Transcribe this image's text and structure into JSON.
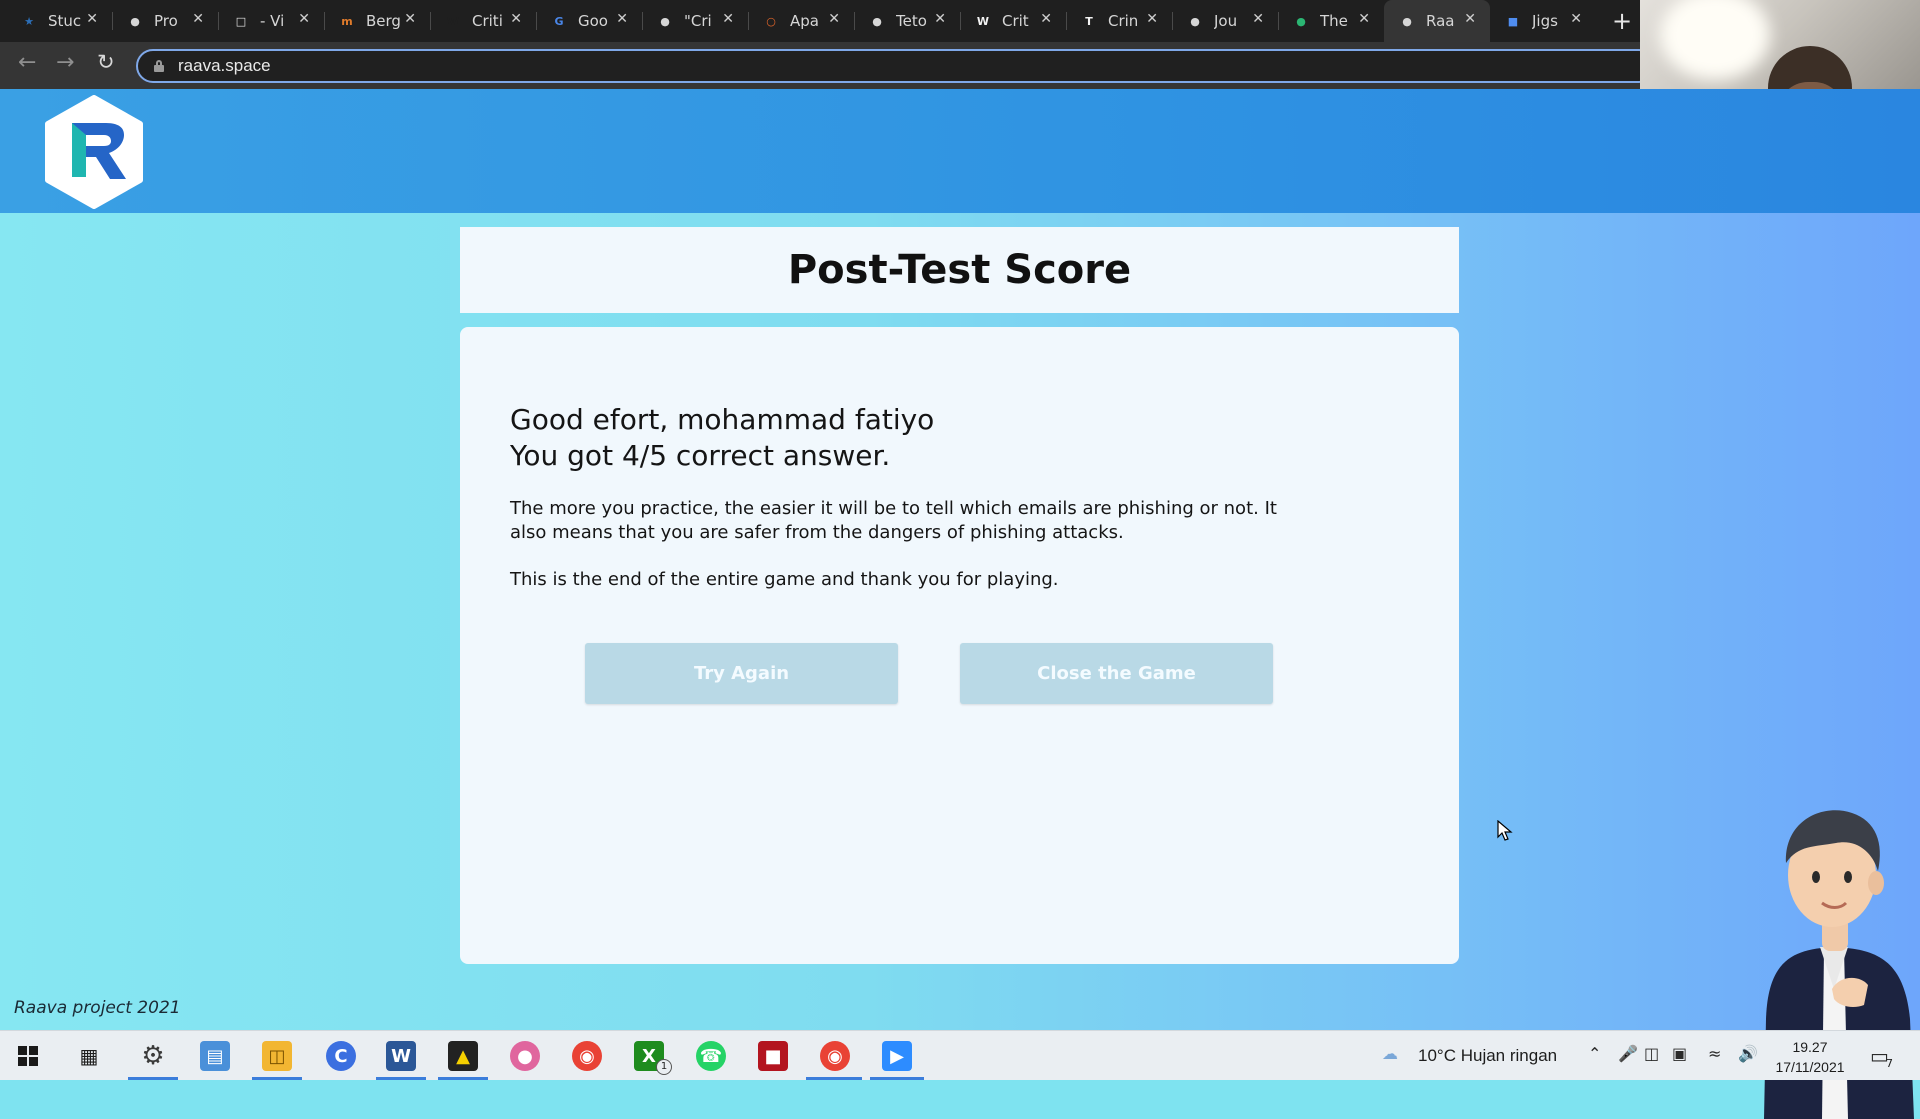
{
  "browser": {
    "tabs": [
      {
        "title": "Stuc",
        "favicon": "student-icon",
        "color": "#2c6fb8"
      },
      {
        "title": "Pro",
        "favicon": "globe-icon",
        "color": "#d6d6d6"
      },
      {
        "title": "- Vi",
        "favicon": "document-icon",
        "color": "#e8e8e8"
      },
      {
        "title": "Berg",
        "favicon": "mb-icon",
        "color": "#e07b2b"
      },
      {
        "title": "Criti",
        "favicon": "wikipedia-w-icon",
        "color": "#1f1f1f"
      },
      {
        "title": "Goo",
        "favicon": "google-translate-icon",
        "color": "#4a86e8"
      },
      {
        "title": "\"Cri",
        "favicon": "globe-icon",
        "color": "#d6d6d6"
      },
      {
        "title": "Apa",
        "favicon": "ring-icon",
        "color": "#e6672a"
      },
      {
        "title": "Teto",
        "favicon": "globe-icon",
        "color": "#d6d6d6"
      },
      {
        "title": "Crit",
        "favicon": "wikipedia-icon",
        "color": "#f2f2f2"
      },
      {
        "title": "Crin",
        "favicon": "book-icon",
        "color": "#f2f2f2"
      },
      {
        "title": "Jou",
        "favicon": "globe-icon",
        "color": "#d6d6d6"
      },
      {
        "title": "The",
        "favicon": "green-circle-icon",
        "color": "#2bb673"
      },
      {
        "title": "Raa",
        "favicon": "globe-icon",
        "color": "#d6d6d6",
        "active": true
      },
      {
        "title": "Jigs",
        "favicon": "blue-square-icon",
        "color": "#4f8df0"
      }
    ],
    "url": "raava.space"
  },
  "page": {
    "title": "Post-Test Score",
    "greeting_line1": "Good efort, mohammad fatiyo",
    "greeting_line2": "You got 4/5 correct answer.",
    "message": "The more you practice, the easier it will be to tell which emails are phishing or not. It also means that you are safer from the dangers of phishing attacks.",
    "closing": "This is the end of the entire game and thank you for playing.",
    "try_again_label": "Try Again",
    "close_game_label": "Close the Game",
    "footer": "Raava project 2021",
    "logo_letter": "R"
  },
  "taskbar": {
    "weather": "10°C  Hujan ringan",
    "time": "19.27",
    "date": "17/11/2021",
    "notification_count": "7",
    "xbox_badge": "1"
  }
}
